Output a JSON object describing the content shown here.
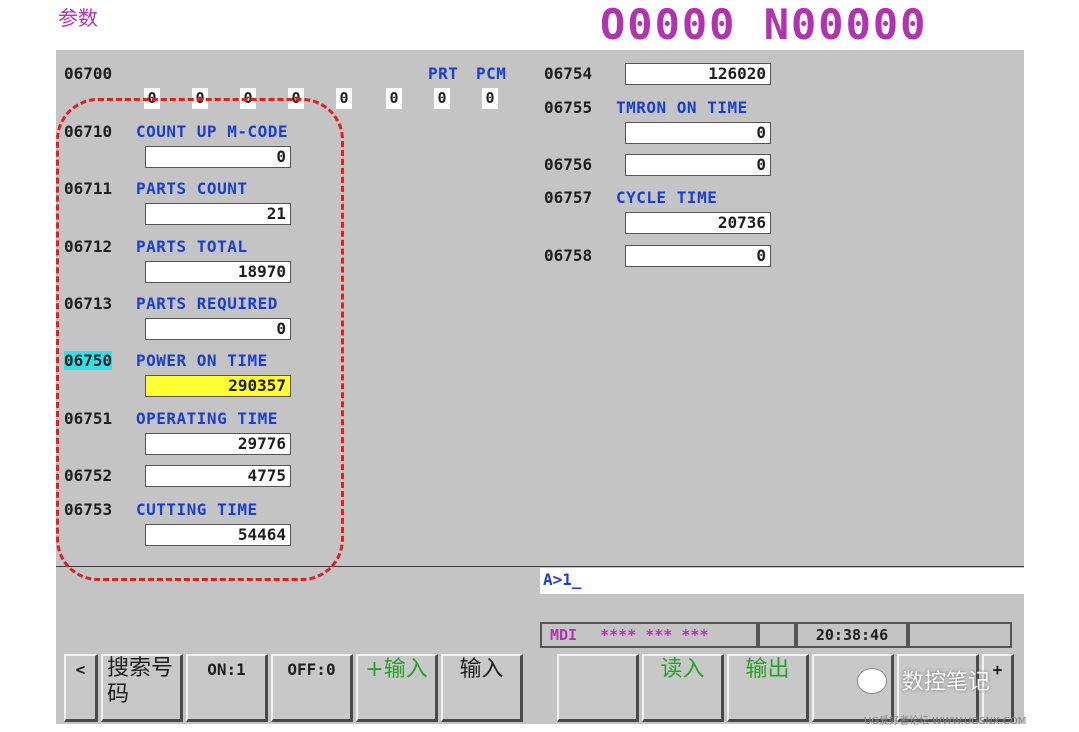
{
  "header": {
    "title": "参数",
    "program_number": "O0000 N00000"
  },
  "param_06700": {
    "number": "06700",
    "bit_labels": [
      "PRT",
      "PCM"
    ],
    "bits": [
      "0",
      "0",
      "0",
      "0",
      "0",
      "0",
      "0",
      "0"
    ]
  },
  "left_params": [
    {
      "number": "06710",
      "label": "COUNT UP M-CODE",
      "value": "0"
    },
    {
      "number": "06711",
      "label": "PARTS COUNT",
      "value": "21"
    },
    {
      "number": "06712",
      "label": "PARTS TOTAL",
      "value": "18970"
    },
    {
      "number": "06713",
      "label": "PARTS REQUIRED",
      "value": "0"
    },
    {
      "number": "06750",
      "label": "POWER ON TIME",
      "value": "290357",
      "selected": true
    },
    {
      "number": "06751",
      "label": "OPERATING TIME",
      "value": "29776"
    },
    {
      "number": "06752",
      "label": "",
      "value": "4775"
    },
    {
      "number": "06753",
      "label": "CUTTING TIME",
      "value": "54464"
    }
  ],
  "right_params": [
    {
      "number": "06754",
      "label": "",
      "value": "126020"
    },
    {
      "number": "06755",
      "label": "TMRON ON TIME",
      "value": "0"
    },
    {
      "number": "06756",
      "label": "",
      "value": "0"
    },
    {
      "number": "06757",
      "label": "CYCLE TIME",
      "value": "20736"
    },
    {
      "number": "06758",
      "label": "",
      "value": "0"
    }
  ],
  "input_line": "A>1_",
  "status": {
    "mode": "MDI",
    "stars": "**** *** ***",
    "time": "20:38:46"
  },
  "softkeys": {
    "back": "<",
    "search": "搜索号码",
    "on1": "ON:1",
    "off0": "OFF:0",
    "plus_input": "+输入",
    "input": "输入",
    "read": "读入",
    "output": "输出",
    "next": "+"
  },
  "watermark": "数控笔记",
  "footer_watermark": "UG爱好者论坛 WWW.UGSNX.COM",
  "colors": {
    "title": "#b233b2",
    "label": "#1a3fd0",
    "panel": "#c4c4c4",
    "selected_value": "#ffff33",
    "selected_number": "#33e0e8",
    "highlight": "#e02020"
  }
}
